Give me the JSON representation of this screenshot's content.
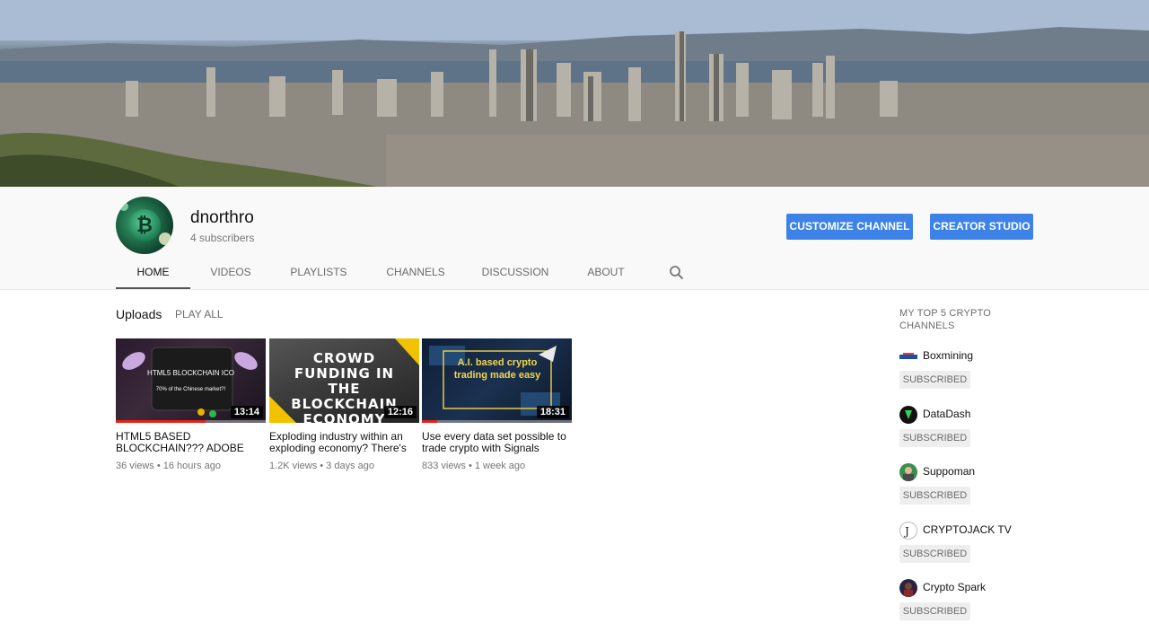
{
  "channel": {
    "name": "dnorthro",
    "subscribers": "4 subscribers",
    "customize_label": "CUSTOMIZE CHANNEL",
    "studio_label": "CREATOR STUDIO"
  },
  "tabs": [
    {
      "label": "HOME",
      "active": true
    },
    {
      "label": "VIDEOS"
    },
    {
      "label": "PLAYLISTS"
    },
    {
      "label": "CHANNELS"
    },
    {
      "label": "DISCUSSION"
    },
    {
      "label": "ABOUT"
    }
  ],
  "uploads": {
    "title": "Uploads",
    "play_all": "PLAY ALL",
    "videos": [
      {
        "title": "HTML5 BASED BLOCKCHAIN??? ADOBE",
        "meta": "36 views • 16 hours ago",
        "duration": "13:14",
        "thumb_text_1": "HTML5 BLOCKCHAIN ICO",
        "thumb_text_2": "70% of the Chinese market?!",
        "watched": 0.6
      },
      {
        "title": "Exploding industry within an exploding economy? There's",
        "meta": "1.2K views • 3 days ago",
        "duration": "12:16",
        "thumb_text_1": "CROWD FUNDING IN THE BLOCKCHAIN ECONOMY",
        "watched": 0.0
      },
      {
        "title": "Use every data set possible to trade crypto with Signals",
        "meta": "833 views • 1 week ago",
        "duration": "18:31",
        "thumb_text_1": "A.I. based crypto trading made easy",
        "watched": 0.1
      }
    ]
  },
  "sidebar": {
    "title": "MY TOP 5 CRYPTO CHANNELS",
    "subscribed_label": "SUBSCRIBED",
    "channels": [
      {
        "name": "Boxmining"
      },
      {
        "name": "DataDash"
      },
      {
        "name": "Suppoman"
      },
      {
        "name": "CRYPTOJACK TV"
      },
      {
        "name": "Crypto Spark"
      }
    ]
  },
  "colors": {
    "accent_blue": "#3d82e6",
    "progress_red": "#e62117"
  },
  "icons": [
    "search-icon"
  ]
}
